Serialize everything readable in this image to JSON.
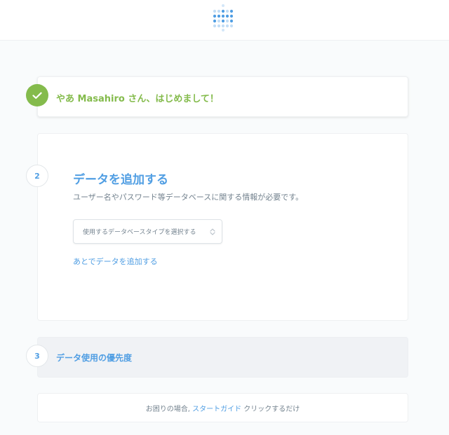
{
  "logo": {
    "icon": "metabase-logo-icon",
    "color": "#509ee3"
  },
  "steps": {
    "greeting": {
      "status_icon": "checkmark-icon",
      "text": "やあ Masahiro さん、はじめまして！",
      "color": "#84bb4c"
    },
    "add_data": {
      "number": "2",
      "title": "データを追加する",
      "description": "ユーザー名やパスワード等データベースに関する情報が必要です。",
      "select": {
        "placeholder": "使用するデータベースタイプを選択する",
        "caret_icon": "sort-caret-icon"
      },
      "add_later_link": "あとでデータを追加する"
    },
    "data_priority": {
      "number": "3",
      "title": "データ使用の優先度"
    }
  },
  "help": {
    "prefix": "お困りの場合,",
    "link": "スタートガイド",
    "suffix": "クリックするだけ"
  },
  "colors": {
    "accent": "#509ee3",
    "success": "#84bb4c",
    "text_muted": "#74838f"
  }
}
